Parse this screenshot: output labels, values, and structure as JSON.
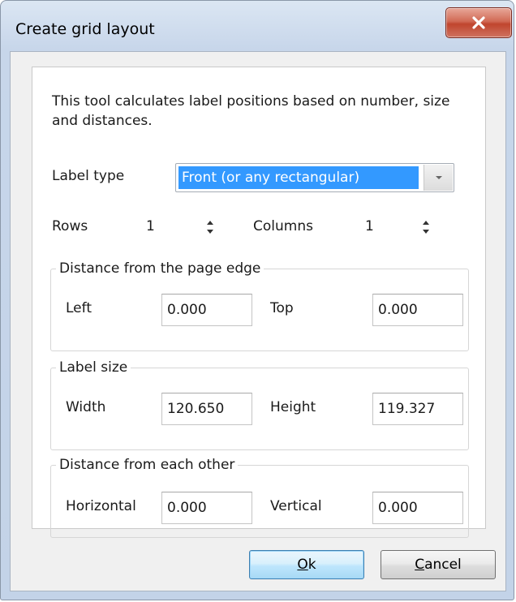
{
  "window": {
    "title": "Create grid layout"
  },
  "description": "This tool calculates label positions based on number, size and distances.",
  "label_type": {
    "label": "Label type",
    "selected": "Front (or any rectangular)"
  },
  "rows": {
    "label": "Rows",
    "value": "1"
  },
  "columns": {
    "label": "Columns",
    "value": "1"
  },
  "page_edge": {
    "title": "Distance from the page edge",
    "left_label": "Left",
    "left_value": "0.000",
    "top_label": "Top",
    "top_value": "0.000"
  },
  "label_size": {
    "title": "Label size",
    "width_label": "Width",
    "width_value": "120.650",
    "height_label": "Height",
    "height_value": "119.327"
  },
  "each_other": {
    "title": "Distance from each other",
    "horizontal_label": "Horizontal",
    "horizontal_value": "0.000",
    "vertical_label": "Vertical",
    "vertical_value": "0.000"
  },
  "buttons": {
    "ok_mnemonic": "O",
    "ok_rest": "k",
    "cancel_mnemonic": "C",
    "cancel_rest": "ancel"
  },
  "icons": {
    "close": "close-icon",
    "dropdown": "chevron-down-icon",
    "spin": "spin-arrows-icon"
  },
  "colors": {
    "selection": "#3399ff",
    "close_button": "#c0452e",
    "default_button": "#3c7fb1"
  }
}
